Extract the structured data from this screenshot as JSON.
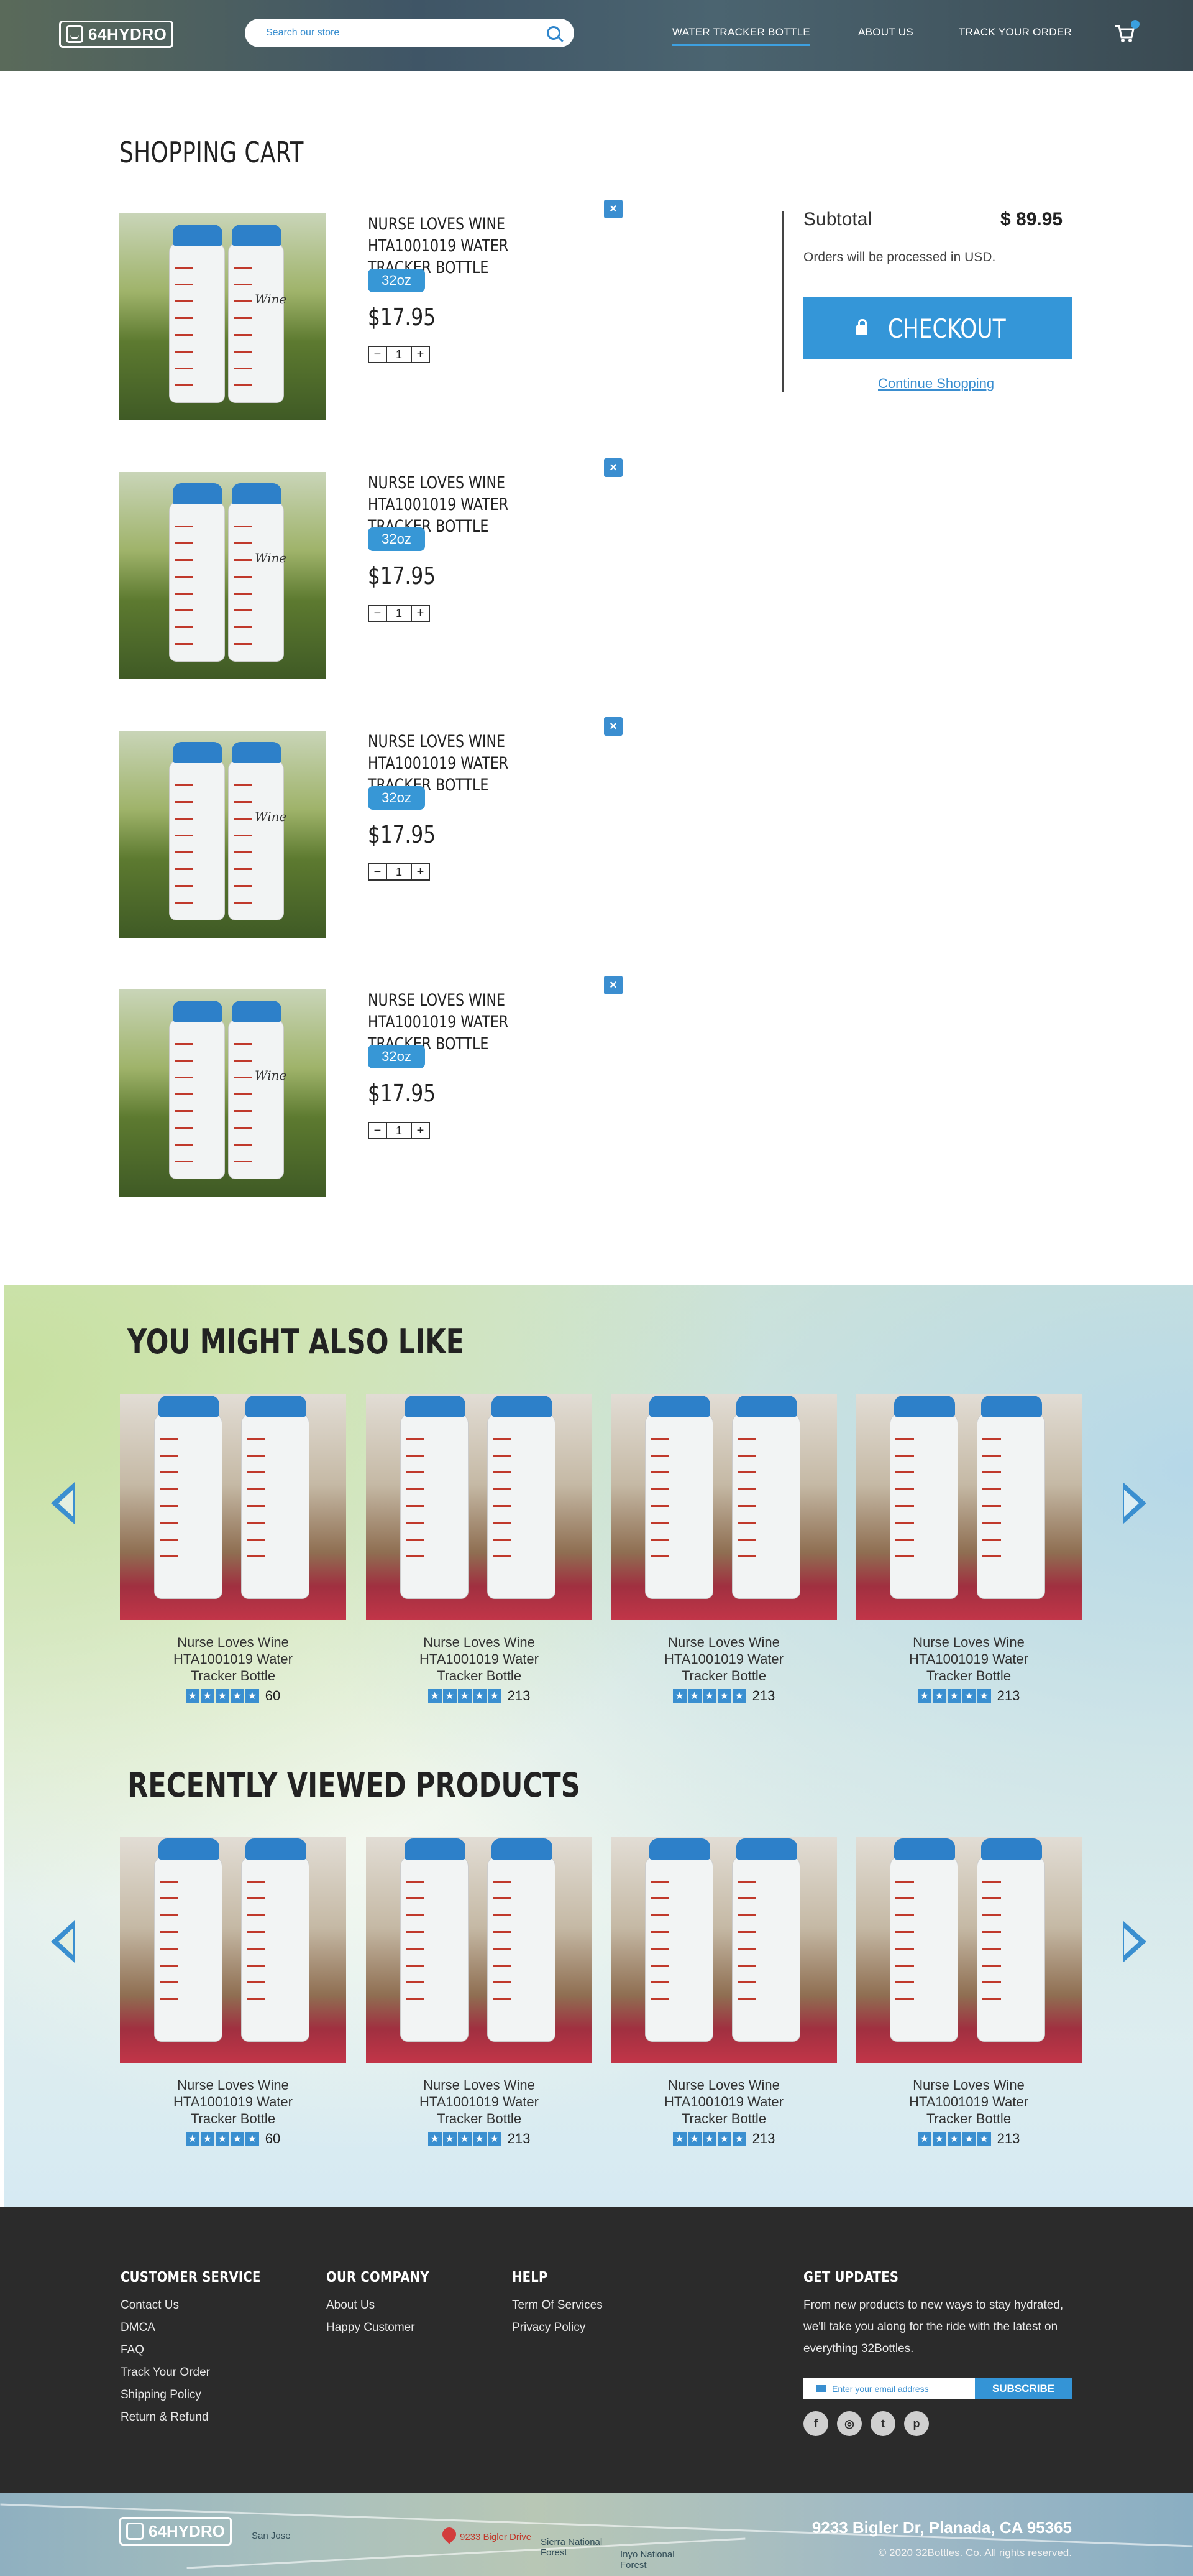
{
  "header": {
    "logo": "64HYDRO",
    "search_placeholder": "Search our store",
    "nav": [
      "WATER TRACKER BOTTLE",
      "ABOUT US",
      "TRACK YOUR ORDER"
    ]
  },
  "cart": {
    "title": "SHOPPING CART",
    "items": [
      {
        "name": "NURSE LOVES WINE HTA1001019 WATER TRACKER BOTTLE",
        "size": "32oz",
        "price": "$17.95",
        "qty": "1",
        "minus": "−",
        "plus": "+",
        "remove": "×"
      },
      {
        "name": "NURSE LOVES WINE HTA1001019 WATER TRACKER BOTTLE",
        "size": "32oz",
        "price": "$17.95",
        "qty": "1",
        "minus": "−",
        "plus": "+",
        "remove": "×"
      },
      {
        "name": "NURSE LOVES WINE HTA1001019 WATER TRACKER BOTTLE",
        "size": "32oz",
        "price": "$17.95",
        "qty": "1",
        "minus": "−",
        "plus": "+",
        "remove": "×"
      },
      {
        "name": "NURSE LOVES WINE HTA1001019 WATER TRACKER BOTTLE",
        "size": "32oz",
        "price": "$17.95",
        "qty": "1",
        "minus": "−",
        "plus": "+",
        "remove": "×"
      }
    ],
    "bottle_text": "Wine"
  },
  "summary": {
    "subtotal_label": "Subtotal",
    "subtotal_value": "$ 89.95",
    "currency_note": "Orders will be processed in USD.",
    "checkout_label": "CHECKOUT",
    "continue_label": "Continue Shopping"
  },
  "also_like": {
    "title": "YOU MIGHT ALSO LIKE",
    "products": [
      {
        "name": "Nurse Loves Wine HTA1001019 Water Tracker Bottle",
        "reviews": "60"
      },
      {
        "name": "Nurse Loves Wine HTA1001019 Water Tracker Bottle",
        "reviews": "213"
      },
      {
        "name": "Nurse Loves Wine HTA1001019 Water Tracker Bottle",
        "reviews": "213"
      },
      {
        "name": "Nurse Loves Wine HTA1001019 Water Tracker Bottle",
        "reviews": "213"
      }
    ]
  },
  "recently_viewed": {
    "title": "RECENTLY VIEWED PRODUCTS",
    "products": [
      {
        "name": "Nurse Loves Wine HTA1001019 Water Tracker Bottle",
        "reviews": "60"
      },
      {
        "name": "Nurse Loves Wine HTA1001019 Water Tracker Bottle",
        "reviews": "213"
      },
      {
        "name": "Nurse Loves Wine HTA1001019 Water Tracker Bottle",
        "reviews": "213"
      },
      {
        "name": "Nurse Loves Wine HTA1001019 Water Tracker Bottle",
        "reviews": "213"
      }
    ]
  },
  "star": "★",
  "footer": {
    "customer_service": {
      "title": "CUSTOMER SERVICE",
      "links": [
        "Contact Us",
        "DMCA",
        "FAQ",
        "Track Your Order",
        "Shipping Policy",
        "Return & Refund"
      ]
    },
    "our_company": {
      "title": "OUR COMPANY",
      "links": [
        "About Us",
        "Happy Customer"
      ]
    },
    "help": {
      "title": "HELP",
      "links": [
        "Term Of Services",
        "Privacy Policy"
      ]
    },
    "updates": {
      "title": "GET UPDATES",
      "text": "From new products to new ways to stay hydrated, we'll take you along for the ride with the latest on everything 32Bottles.",
      "email_placeholder": "Enter your email address",
      "subscribe_label": "SUBSCRIBE",
      "socials": [
        "f",
        "◎",
        "t",
        "p"
      ]
    }
  },
  "bottom": {
    "logo": "64HYDRO",
    "address": "9233 Bigler Dr, Planada, CA 95365",
    "copyright": "© 2020 32Bottles. Co. All rights reserved.",
    "map_labels": [
      "San Jose",
      "9233 Bigler Drive",
      "Sierra National Forest",
      "Inyo National Forest"
    ]
  },
  "colors": {
    "accent": "#3496d8",
    "footer_bg": "#2b2b2b"
  }
}
